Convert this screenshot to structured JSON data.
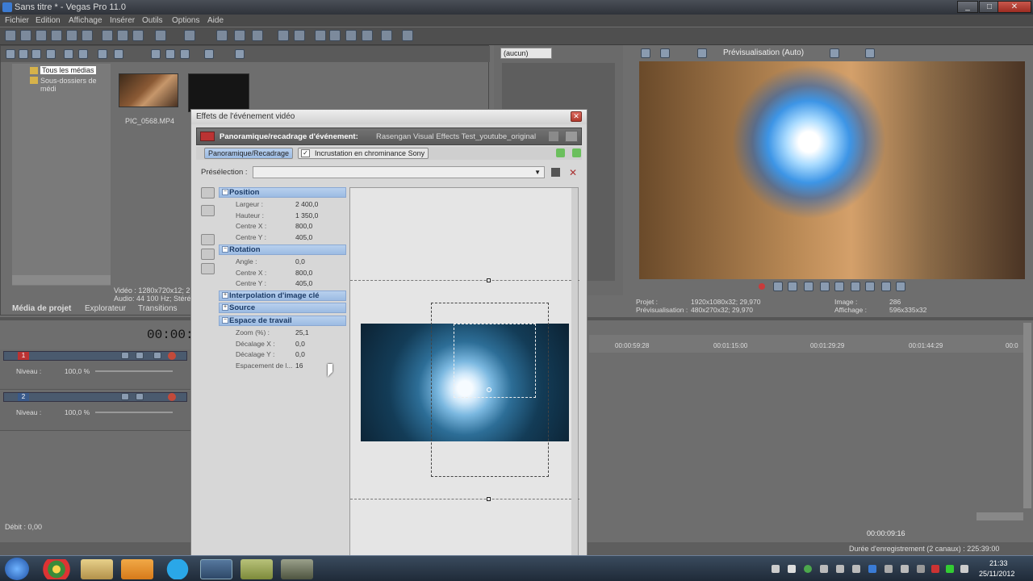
{
  "window": {
    "title": "Sans titre * - Vegas Pro 11.0",
    "controls": [
      "_",
      "□",
      "✕"
    ]
  },
  "menu": [
    "Fichier",
    "Edition",
    "Affichage",
    "Insérer",
    "Outils",
    "Options",
    "Aide"
  ],
  "explorer": {
    "tree": [
      "Tous les médias",
      "Sous-dossiers de médi"
    ],
    "thumb_label": "PIC_0568.MP4",
    "media_info": [
      "Vidéo : 1280x720x12; 2",
      "Audio: 44 100 Hz; Stéréo"
    ],
    "tabs": [
      "Média de projet",
      "Explorateur",
      "Transitions"
    ]
  },
  "trimmer": {
    "dropdown": "(aucun)"
  },
  "timecode": "00:00:0",
  "tracks": [
    {
      "number": "1",
      "level_label": "Niveau :",
      "level_value": "100,0 %"
    },
    {
      "number": "2",
      "level_label": "Niveau :",
      "level_value": "100,0 %"
    }
  ],
  "rate": "Débit : 0,00",
  "dialog": {
    "title": "Effets de l'événement vidéo",
    "fx_title": "Panoramique/recadrage d'événement:",
    "fx_event": "Rasengan Visual Effects Test_youtube_original",
    "chain": [
      "Panoramique/Recadrage",
      "Incrustation en chrominance Sony"
    ],
    "preset_label": "Présélection :",
    "sections": [
      {
        "label": "Position",
        "sign": "−",
        "rows": [
          {
            "k": "Largeur :",
            "v": "2 400,0"
          },
          {
            "k": "Hauteur :",
            "v": "1 350,0"
          },
          {
            "k": "Centre X :",
            "v": "800,0"
          },
          {
            "k": "Centre Y :",
            "v": "405,0"
          }
        ]
      },
      {
        "label": "Rotation",
        "sign": "−",
        "rows": [
          {
            "k": "Angle :",
            "v": "0,0"
          },
          {
            "k": "Centre X :",
            "v": "800,0"
          },
          {
            "k": "Centre Y :",
            "v": "405,0"
          }
        ]
      },
      {
        "label": "Interpolation d'image clé",
        "sign": "+",
        "rows": []
      },
      {
        "label": "Source",
        "sign": "+",
        "rows": []
      },
      {
        "label": "Espace de travail",
        "sign": "−",
        "rows": [
          {
            "k": "Zoom (%) :",
            "v": "25,1"
          },
          {
            "k": "Décalage X :",
            "v": "0,0"
          },
          {
            "k": "Décalage Y :",
            "v": "0,0"
          },
          {
            "k": "Espacement de l...",
            "v": "16"
          }
        ]
      }
    ]
  },
  "preview": {
    "mode": "Prévisualisation (Auto)",
    "info_labels": [
      "Projet :",
      "Prévisualisation :",
      "Image :",
      "Affichage :"
    ],
    "info_values": [
      "1920x1080x32; 29,970",
      "480x270x32; 29,970",
      "286",
      "596x335x32"
    ]
  },
  "ruler": [
    "00:00:59:28",
    "00:01:15:00",
    "00:01:29:29",
    "00:01:44:29",
    "00:0"
  ],
  "status": {
    "time": "00:00:09:16",
    "record": "Durée d'enregistrement (2 canaux) : 225:39:00"
  },
  "clock": {
    "time": "21:33",
    "date": "25/11/2012"
  },
  "colors": {
    "accent": "#9cbbe3",
    "title_bar": "#2f333a",
    "orb": "#3d95e6"
  }
}
